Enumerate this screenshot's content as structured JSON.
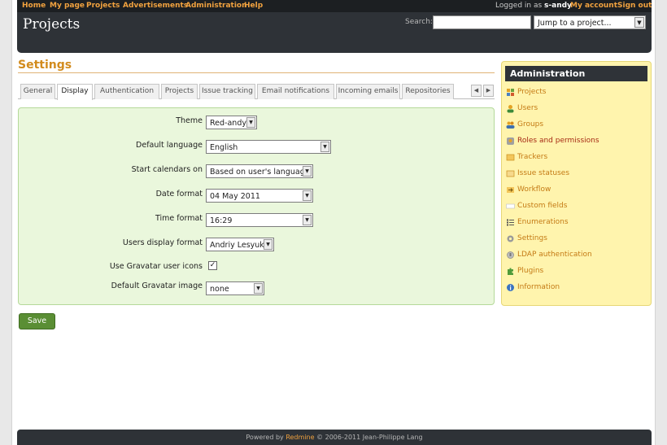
{
  "top_menu": {
    "home": "Home",
    "my_page": "My page",
    "projects": "Projects",
    "advertisements": "Advertisements",
    "administration": "Administration",
    "help": "Help",
    "logged_in_as": "Logged in as",
    "user": "s-andy",
    "my_account": "My account",
    "sign_out": "Sign out"
  },
  "header": {
    "title": "Projects",
    "search_label": "Search:",
    "search_value": "",
    "jump_label": "Jump to a project..."
  },
  "main": {
    "title": "Settings",
    "tabs": [
      {
        "label": "General"
      },
      {
        "label": "Display"
      },
      {
        "label": "Authentication"
      },
      {
        "label": "Projects"
      },
      {
        "label": "Issue tracking"
      },
      {
        "label": "Email notifications"
      },
      {
        "label": "Incoming emails"
      },
      {
        "label": "Repositories"
      }
    ],
    "selected_tab": "Display",
    "form": {
      "theme": {
        "label": "Theme",
        "value": "Red-andy"
      },
      "default_language": {
        "label": "Default language",
        "value": "English"
      },
      "start_calendars": {
        "label": "Start calendars on",
        "value": "Based on user's language"
      },
      "date_format": {
        "label": "Date format",
        "value": "04 May 2011"
      },
      "time_format": {
        "label": "Time format",
        "value": "16:29"
      },
      "users_display_format": {
        "label": "Users display format",
        "value": "Andriy Lesyuk"
      },
      "use_gravatar": {
        "label": "Use Gravatar user icons",
        "checked": true
      },
      "default_gravatar": {
        "label": "Default Gravatar image",
        "value": "none"
      }
    },
    "save_label": "Save"
  },
  "sidebar": {
    "title": "Administration",
    "items": [
      {
        "label": "Projects",
        "icon": "projects-icon"
      },
      {
        "label": "Users",
        "icon": "users-icon"
      },
      {
        "label": "Groups",
        "icon": "groups-icon"
      },
      {
        "label": "Roles and permissions",
        "icon": "roles-icon",
        "current": true
      },
      {
        "label": "Trackers",
        "icon": "trackers-icon"
      },
      {
        "label": "Issue statuses",
        "icon": "issue-statuses-icon"
      },
      {
        "label": "Workflow",
        "icon": "workflow-icon"
      },
      {
        "label": "Custom fields",
        "icon": "custom-fields-icon"
      },
      {
        "label": "Enumerations",
        "icon": "enumerations-icon"
      },
      {
        "label": "Settings",
        "icon": "settings-icon"
      },
      {
        "label": "LDAP authentication",
        "icon": "ldap-icon"
      },
      {
        "label": "Plugins",
        "icon": "plugins-icon"
      },
      {
        "label": "Information",
        "icon": "information-icon"
      }
    ]
  },
  "footer": {
    "powered_by": "Powered by",
    "redmine": "Redmine",
    "copyright": "© 2006-2011 Jean-Philippe Lang"
  },
  "colors": {
    "accent": "#d28b1d",
    "link": "#c47a14",
    "header_bg": "#2e3237",
    "form_bg": "#eaf7dc",
    "sidebar_bg": "#fff4ad",
    "save_button": "#5a8e34"
  }
}
